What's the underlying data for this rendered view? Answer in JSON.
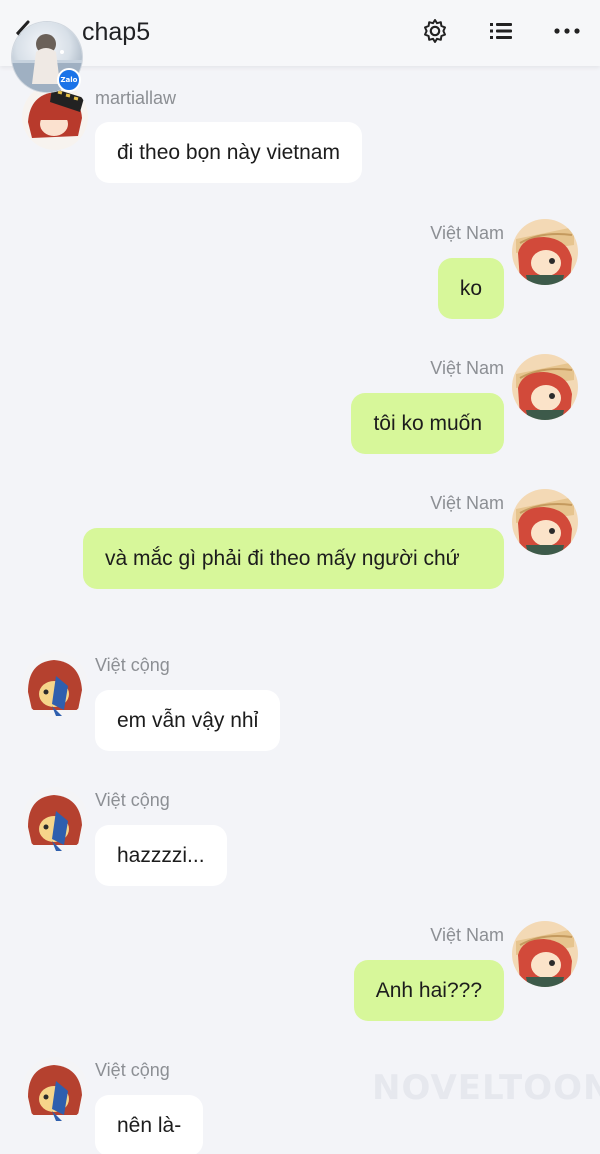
{
  "header": {
    "title": "chap5",
    "zalo_badge": "Zalo",
    "icons": [
      "chevron-left-icon",
      "gear-icon",
      "list-icon",
      "more-dots-icon"
    ]
  },
  "messages": [
    {
      "sender": "martiallaw",
      "text": "đi theo bọn này vietnam",
      "side": "left"
    },
    {
      "sender": "Việt Nam",
      "text": "ko",
      "side": "right"
    },
    {
      "sender": "Việt Nam",
      "text": "tôi ko muốn",
      "side": "right"
    },
    {
      "sender": "Việt Nam",
      "text": "và mắc gì phải đi theo mấy người chứ",
      "side": "right"
    },
    {
      "sender": "Việt cộng",
      "text": "em vẫn vậy nhỉ",
      "side": "left"
    },
    {
      "sender": "Việt cộng",
      "text": "hazzzzi...",
      "side": "left"
    },
    {
      "sender": "Việt Nam",
      "text": "Anh hai???",
      "side": "right"
    },
    {
      "sender": "Việt cộng",
      "text": "nên là-",
      "side": "left"
    }
  ],
  "watermark": "NOVELTOON",
  "colors": {
    "background": "#f3f4f8",
    "incoming_bubble": "#ffffff",
    "outgoing_bubble": "#d7f79a",
    "sender_name": "#8c8f94"
  }
}
